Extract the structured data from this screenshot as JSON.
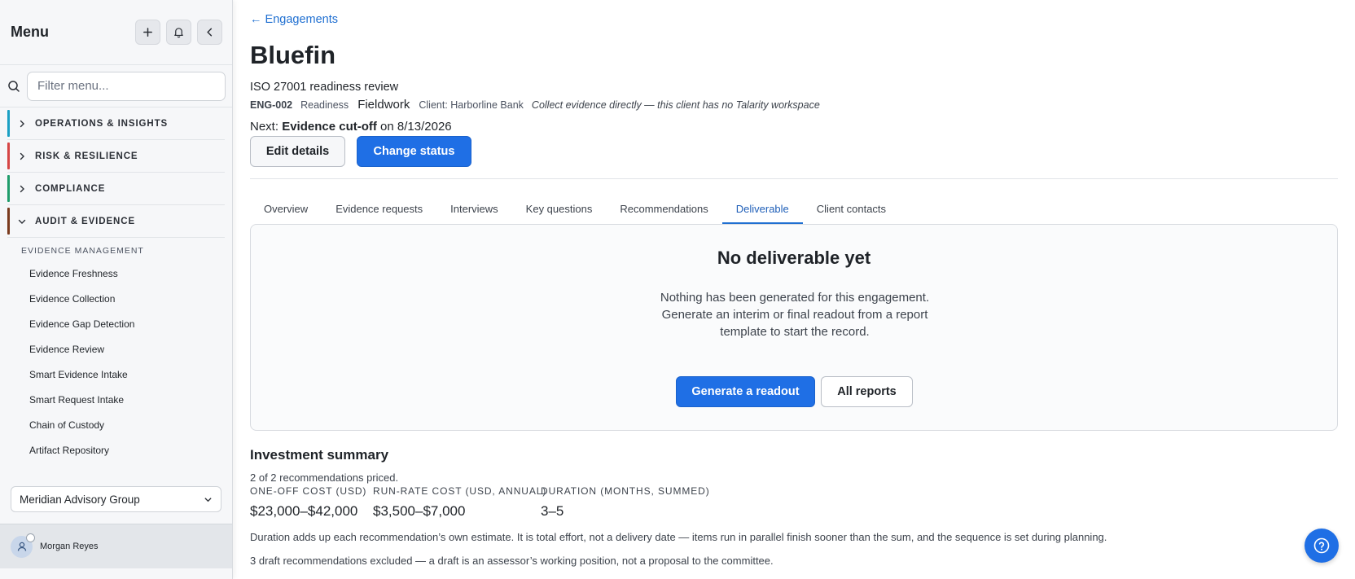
{
  "sidebar": {
    "title": "Menu",
    "buttons": {
      "add_icon": "plus-icon",
      "bell_icon": "bell-icon",
      "collapse_icon": "chevron-left-icon"
    },
    "search_placeholder": "Filter menu...",
    "sections": [
      {
        "label": "OPERATIONS & INSIGHTS",
        "color": "#1aa0c4",
        "expanded": false
      },
      {
        "label": "RISK & RESILIENCE",
        "color": "#d64545",
        "expanded": false
      },
      {
        "label": "COMPLIANCE",
        "color": "#1f9d6b",
        "expanded": false
      },
      {
        "label": "AUDIT & EVIDENCE",
        "color": "#7a3b1e",
        "expanded": true
      }
    ],
    "group_label": "EVIDENCE MANAGEMENT",
    "items": [
      {
        "label": "Evidence Freshness"
      },
      {
        "label": "Evidence Collection"
      },
      {
        "label": "Evidence Gap Detection"
      },
      {
        "label": "Evidence Review"
      },
      {
        "label": "Smart Evidence Intake"
      },
      {
        "label": "Smart Request Intake"
      },
      {
        "label": "Chain of Custody"
      },
      {
        "label": "Artifact Repository"
      }
    ],
    "org_select": "Meridian Advisory Group",
    "user_name": "Morgan Reyes"
  },
  "main": {
    "back_link": "← Engagements",
    "title": "Bluefin",
    "subtitle": "ISO 27001 readiness review",
    "meta": {
      "code": "ENG-002",
      "phase": "Readiness",
      "stage": "Fieldwork",
      "client": "Client: Harborline Bank",
      "note": "Collect evidence directly — this client has no Talarity workspace"
    },
    "next": {
      "prefix": "Next:",
      "event": "Evidence cut-off",
      "suffix": "on 8/13/2026"
    },
    "actions": {
      "edit": "Edit details",
      "change_status": "Change status"
    },
    "tabs": [
      {
        "label": "Overview",
        "active": false
      },
      {
        "label": "Evidence requests",
        "active": false
      },
      {
        "label": "Interviews",
        "active": false
      },
      {
        "label": "Key questions",
        "active": false
      },
      {
        "label": "Recommendations",
        "active": false
      },
      {
        "label": "Deliverable",
        "active": true
      },
      {
        "label": "Client contacts",
        "active": false
      }
    ],
    "deliverable": {
      "title": "No deliverable yet",
      "body": "Nothing has been generated for this engagement. Generate an interim or final readout from a report template to start the record.",
      "primary": "Generate a readout",
      "secondary": "All reports"
    },
    "investment": {
      "title": "Investment summary",
      "priced": "2 of 2 recommendations priced.",
      "metrics": [
        {
          "label": "ONE-OFF COST (USD)",
          "value": "$23,000–$42,000"
        },
        {
          "label": "RUN-RATE COST (USD, ANNUAL)",
          "value": "$3,500–$7,000"
        },
        {
          "label": "DURATION (MONTHS, SUMMED)",
          "value": "3–5"
        }
      ],
      "note1": "Duration adds up each recommendation’s own estimate. It is total effort, not a delivery date — items run in parallel finish sooner than the sum, and the sequence is set during planning.",
      "note2": "3 draft recommendations excluded — a draft is an assessor’s working position, not a proposal to the committee."
    }
  },
  "help_icon": "help-circle-icon",
  "colors": {
    "accent": "#1f6fe5",
    "link": "#1f6fd1"
  }
}
